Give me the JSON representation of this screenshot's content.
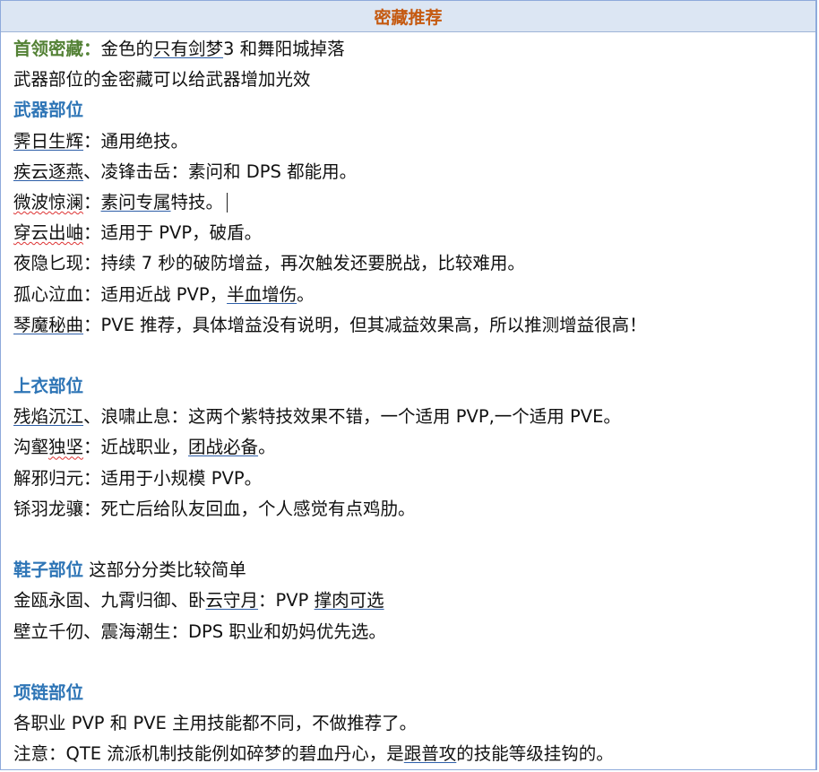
{
  "title": "密藏推荐",
  "intro": {
    "label": "首领密藏：",
    "text_1": "金色的",
    "text_2": "只有剑梦",
    "text_3": "3 和舞阳城掉落",
    "line2": "武器部位的金密藏可以给武器增加光效"
  },
  "weapon": {
    "heading": "武器部位",
    "items": [
      {
        "name": "霁日生辉",
        "desc": "：通用绝技。"
      },
      {
        "name": "疾云逐燕",
        "name_rest": "、凌锋击岳",
        "desc": "：素问和 DPS 都能用。"
      },
      {
        "name": "微波惊澜",
        "desc_1": "：",
        "desc_2": "素问专属",
        "desc_3": "特技。"
      },
      {
        "name": "穿云出岫",
        "desc": "：适用于 PVP，破盾。"
      },
      {
        "name": "夜隐匕现",
        "desc": "：持续 7 秒的破防增益，再次触发还要脱战，比较难用。"
      },
      {
        "name": "孤心泣血",
        "desc_1": "：适用近战 PVP，",
        "desc_2": "半血增伤",
        "desc_3": "。"
      },
      {
        "name": "琴魔秘曲",
        "desc": "：PVE 推荐，具体增益没有说明，但其减益效果高，所以推测增益很高！"
      }
    ]
  },
  "top": {
    "heading": "上衣部位",
    "items": [
      {
        "name": "残焰沉江",
        "desc": "、浪啸止息：这两个紫特技效果不错，一个适用 PVP,一个适用 PVE。"
      },
      {
        "name_1": "沟壑",
        "name_2": "独坚",
        "desc_1": "：近战职业，",
        "desc_2": "团战必备",
        "desc_3": "。"
      },
      {
        "name": "解邪归元",
        "desc": "：适用于小规模 PVP。"
      },
      {
        "name": "铩羽龙骧",
        "desc": "：死亡后给队友回血，个人感觉有点鸡肋。"
      }
    ]
  },
  "shoes": {
    "heading": "鞋子部位",
    "note": " 这部分分类比较简单",
    "line1_a": "金瓯永固、九霄归御、卧",
    "line1_b": "云守月",
    "line1_c": "：PVP ",
    "line1_d": "撑肉可选",
    "line2": "壁立千仞、震海潮生：DPS 职业和奶妈优先选。"
  },
  "necklace": {
    "heading": "项链部位",
    "line1": "各职业 PVP 和 PVE 主用技能都不同，不做推荐了。",
    "line2_a": "注意：QTE 流派机制技能例如碎梦的碧血丹心，是",
    "line2_b": "跟普攻",
    "line2_c": "的技能等级挂钩的。"
  }
}
